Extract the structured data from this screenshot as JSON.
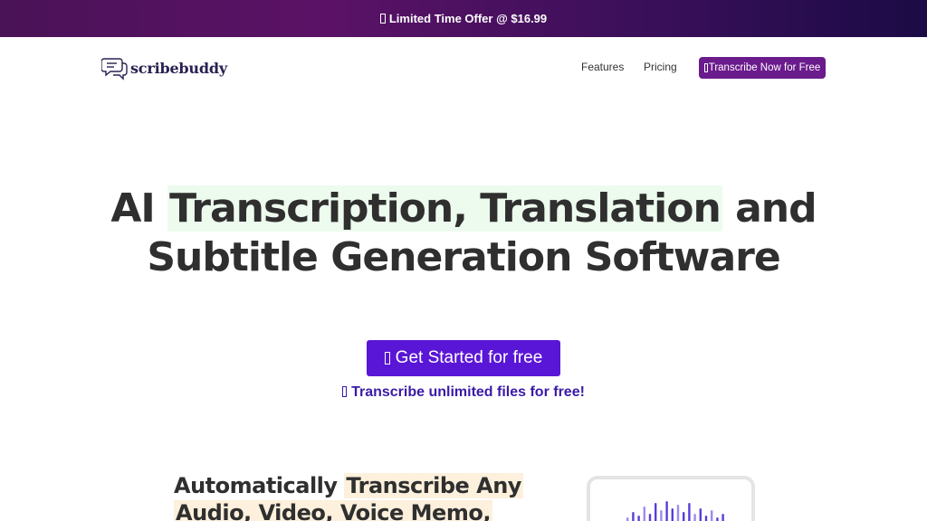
{
  "promo": {
    "text": "Limited Time Offer @ $16.99"
  },
  "nav": {
    "brand": "scribebuddy",
    "links": [
      "Features",
      "Pricing"
    ],
    "cta": "Transcribe Now for Free"
  },
  "hero": {
    "title_pre": "AI ",
    "title_highlight": "Transcription, Translation",
    "title_post": " and",
    "title_line2": "Subtitle Generation Software",
    "cta_button": "Get Started for free",
    "cta_sub": "Transcribe unlimited files for free!"
  },
  "section": {
    "title_pre": "Automatically ",
    "title_highlight": "Transcribe Any",
    "title_line2": "Audio, Video, Voice Memo,"
  },
  "colors": {
    "promo_start": "#4a1257",
    "promo_end": "#1b0b45",
    "nav_cta": "#6a1b8c",
    "primary_button": "#5a16d6",
    "sub_text": "#3a1aa8",
    "title_highlight": "#edfbee",
    "section_highlight": "#fdf0dc"
  },
  "icons": {
    "promo": "glyph-box-icon",
    "logo": "chat-bubbles-icon",
    "nav_cta": "glyph-box-icon",
    "cta_button": "glyph-box-icon",
    "cta_sub": "glyph-box-icon",
    "preview": "waveform-icon"
  }
}
